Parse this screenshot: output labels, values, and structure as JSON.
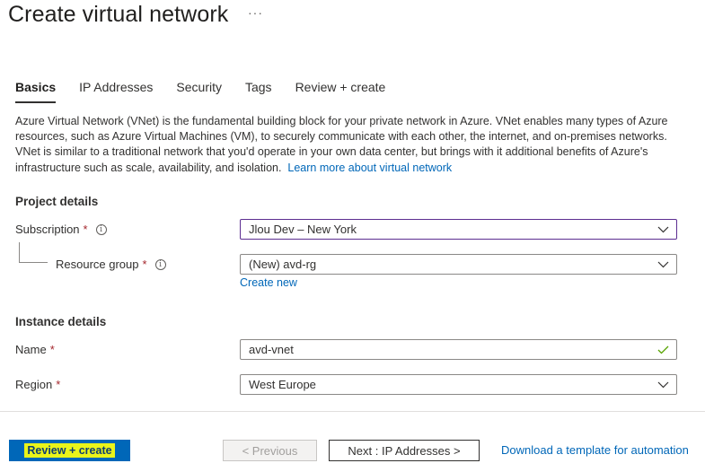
{
  "header": {
    "title": "Create virtual network",
    "more_label": "···"
  },
  "tabs": [
    {
      "label": "Basics",
      "active": true
    },
    {
      "label": "IP Addresses",
      "active": false
    },
    {
      "label": "Security",
      "active": false
    },
    {
      "label": "Tags",
      "active": false
    },
    {
      "label": "Review + create",
      "active": false
    }
  ],
  "description": {
    "text": "Azure Virtual Network (VNet) is the fundamental building block for your private network in Azure. VNet enables many types of Azure resources, such as Azure Virtual Machines (VM), to securely communicate with each other, the internet, and on-premises networks. VNet is similar to a traditional network that you'd operate in your own data center, but brings with it additional benefits of Azure's infrastructure such as scale, availability, and isolation.",
    "link": "Learn more about virtual network"
  },
  "project_details": {
    "title": "Project details",
    "subscription": {
      "label": "Subscription",
      "required": "*",
      "value": "Jlou Dev – New York"
    },
    "resource_group": {
      "label": "Resource group",
      "required": "*",
      "value": "(New) avd-rg",
      "create_new": "Create new"
    }
  },
  "instance_details": {
    "title": "Instance details",
    "name": {
      "label": "Name",
      "required": "*",
      "value": "avd-vnet"
    },
    "region": {
      "label": "Region",
      "required": "*",
      "value": "West Europe"
    }
  },
  "footer": {
    "review_create": "Review + create",
    "previous": "< Previous",
    "next": "Next : IP Addresses >",
    "download": "Download a template for automation"
  },
  "colors": {
    "link": "#0067b8",
    "primary_button": "#0067b8",
    "highlight": "#eaf41a",
    "required": "#a4262c",
    "focus_border": "#5c2d91",
    "valid_check": "#57a300"
  },
  "icons": {
    "info": "info-icon",
    "dropdown": "chevron-down-icon",
    "valid": "checkmark-icon"
  }
}
